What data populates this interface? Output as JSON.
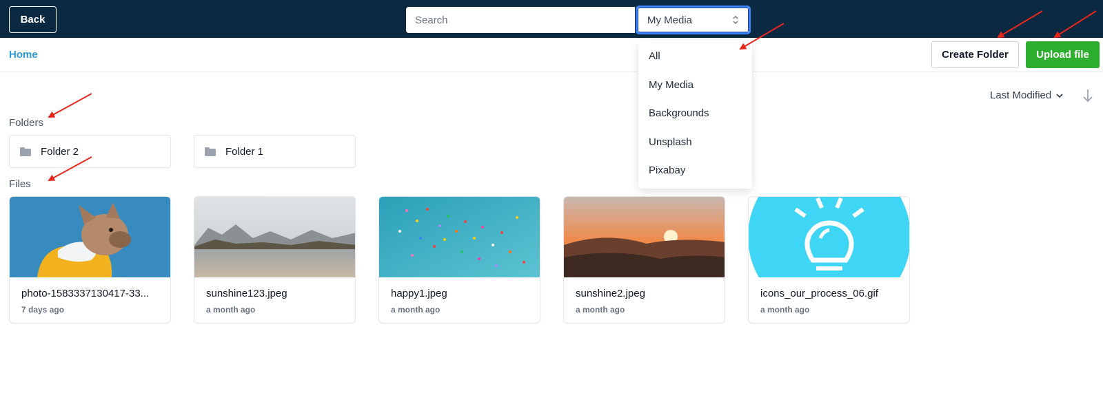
{
  "topbar": {
    "back_label": "Back",
    "search_placeholder": "Search",
    "media_select": {
      "selected": "My Media"
    }
  },
  "subbar": {
    "home_label": "Home",
    "create_folder_label": "Create Folder",
    "upload_label": "Upload file"
  },
  "sort": {
    "label": "Last Modified"
  },
  "folders": {
    "label": "Folders",
    "items": [
      {
        "name": "Folder 2"
      },
      {
        "name": "Folder 1"
      }
    ]
  },
  "files": {
    "label": "Files",
    "items": [
      {
        "name": "photo-1583337130417-33...",
        "date": "7 days ago"
      },
      {
        "name": "sunshine123.jpeg",
        "date": "a month ago"
      },
      {
        "name": "happy1.jpeg",
        "date": "a month ago"
      },
      {
        "name": "sunshine2.jpeg",
        "date": "a month ago"
      },
      {
        "name": "icons_our_process_06.gif",
        "date": "a month ago"
      }
    ]
  },
  "dropdown": {
    "options": [
      "All",
      "My Media",
      "Backgrounds",
      "Unsplash",
      "Pixabay"
    ]
  },
  "colors": {
    "topbar_bg": "#0c2942",
    "link": "#2b9bd6",
    "upload_button": "#2eae2e",
    "annotation_arrow": "#e8271c",
    "select_focus": "#3b82f6"
  },
  "icons": {
    "folder": "folder-icon",
    "select": "updown-chevron-icon",
    "sort": "chevron-down-icon",
    "sort_direction": "arrow-down-icon"
  }
}
